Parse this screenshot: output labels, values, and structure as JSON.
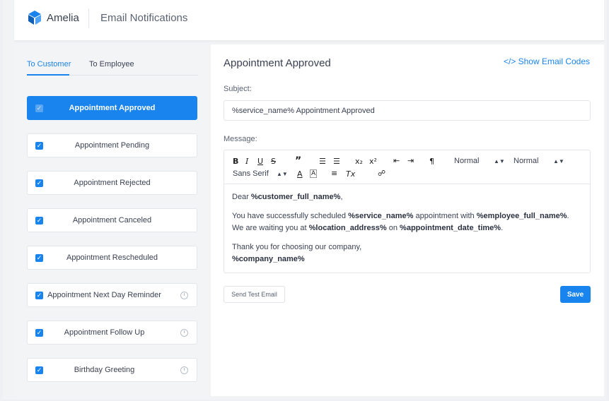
{
  "app": {
    "brand": "Amelia",
    "page_title": "Email Notifications"
  },
  "colors": {
    "accent": "#1a84ee",
    "background": "#f1f3f5",
    "text": "#354052"
  },
  "tabs": [
    {
      "label": "To Customer",
      "active": true
    },
    {
      "label": "To Employee",
      "active": false
    }
  ],
  "notifications": [
    {
      "label": "Appointment Approved",
      "checked": true,
      "active": true,
      "scheduled": false
    },
    {
      "label": "Appointment Pending",
      "checked": true,
      "active": false,
      "scheduled": false
    },
    {
      "label": "Appointment Rejected",
      "checked": true,
      "active": false,
      "scheduled": false
    },
    {
      "label": "Appointment Canceled",
      "checked": true,
      "active": false,
      "scheduled": false
    },
    {
      "label": "Appointment Rescheduled",
      "checked": true,
      "active": false,
      "scheduled": false
    },
    {
      "label": "Appointment Next Day Reminder",
      "checked": true,
      "active": false,
      "scheduled": true
    },
    {
      "label": "Appointment Follow Up",
      "checked": true,
      "active": false,
      "scheduled": true
    },
    {
      "label": "Birthday Greeting",
      "checked": true,
      "active": false,
      "scheduled": true
    }
  ],
  "detail": {
    "title": "Appointment Approved",
    "show_codes": "</> Show Email Codes",
    "subject_label": "Subject:",
    "subject_value": "%service_name% Appointment Approved",
    "message_label": "Message:"
  },
  "toolbar": {
    "bold": "B",
    "italic": "I",
    "underline": "U",
    "strike": "S",
    "quote": "”",
    "ordered_list": "☰",
    "bullet_list": "☰",
    "subscript": "x₂",
    "superscript": "x²",
    "outdent": "⇤",
    "indent": "⇥",
    "direction": "¶",
    "header_select": "Normal",
    "size_select": "Normal",
    "font_select": "Sans Serif",
    "font_color": "A",
    "background_color": "A",
    "align": "≡",
    "clear_format": "Tx",
    "link": "☍"
  },
  "message": {
    "greeting_prefix": "Dear ",
    "greeting_code": "%customer_full_name%",
    "greeting_suffix": ",",
    "line1_a": "You have successfully scheduled ",
    "line1_code1": "%service_name%",
    "line1_b": " appointment with ",
    "line1_code2": "%employee_full_name%",
    "line1_c": ". We are waiting you at ",
    "line1_code3": "%location_address%",
    "line1_d": " on ",
    "line1_code4": "%appointment_date_time%",
    "line1_e": ".",
    "thanks": "Thank you for choosing our company,",
    "signature_code": "%company_name%"
  },
  "buttons": {
    "send_test": "Send Test Email",
    "save": "Save"
  }
}
